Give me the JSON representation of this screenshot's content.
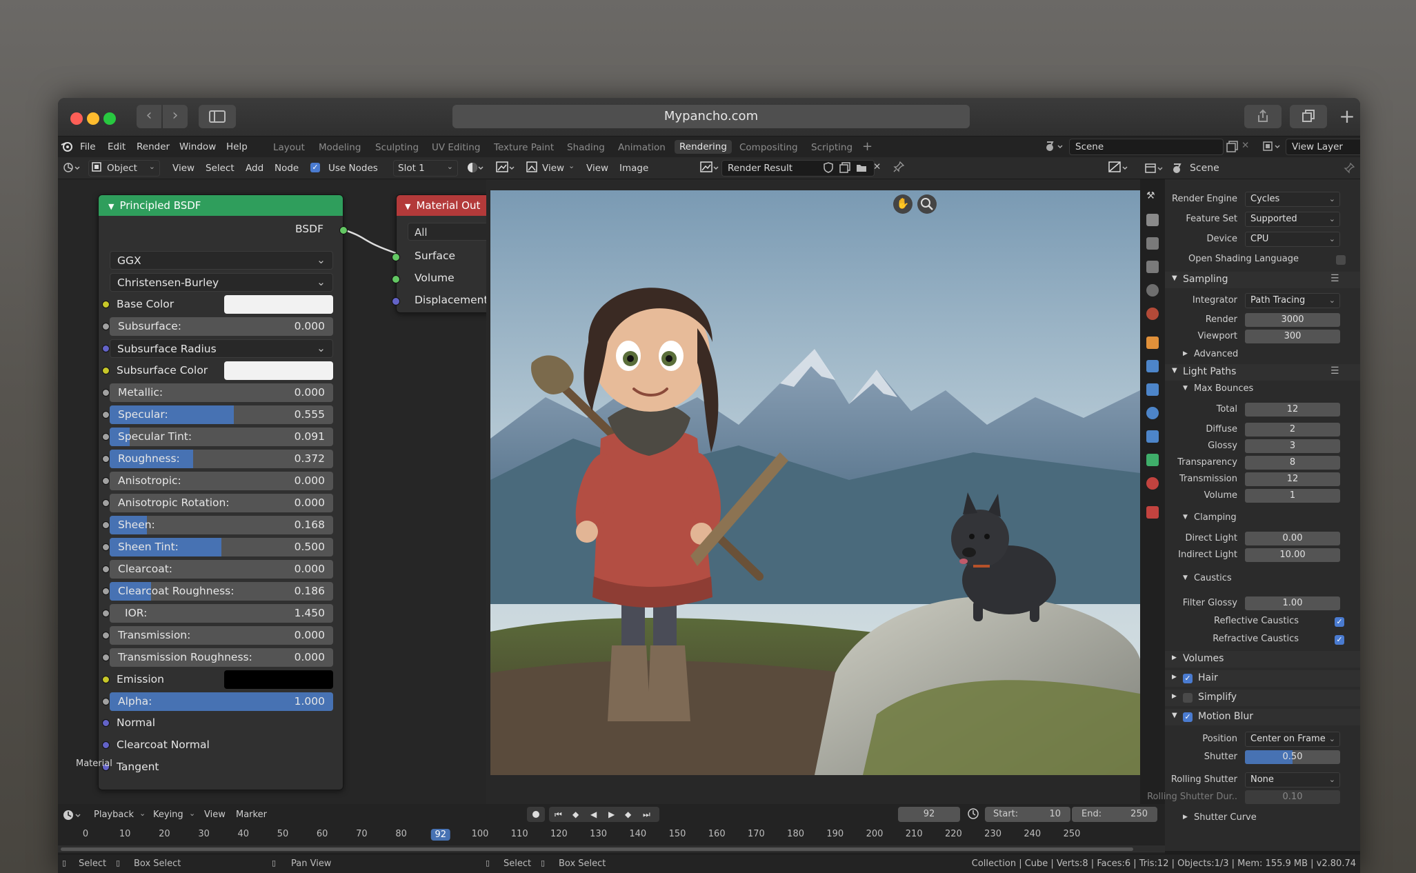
{
  "browser": {
    "url": "Mypancho.com"
  },
  "menu": {
    "items": [
      "File",
      "Edit",
      "Render",
      "Window",
      "Help"
    ],
    "workspaces": [
      "Layout",
      "Modeling",
      "Sculpting",
      "UV Editing",
      "Texture Paint",
      "Shading",
      "Animation",
      "Rendering",
      "Compositing",
      "Scripting"
    ],
    "active_workspace": "Rendering",
    "scene": "Scene",
    "view_layer": "View Layer"
  },
  "node_header": {
    "mode": "Object",
    "view": "View",
    "select": "Select",
    "add": "Add",
    "node": "Node",
    "use_nodes": "Use Nodes",
    "slot": "Slot 1"
  },
  "image_header": {
    "view": "View",
    "view2": "View",
    "image": "Image",
    "render_result": "Render Result"
  },
  "principled": {
    "title": "Principled BSDF",
    "output": "BSDF",
    "distribution": "GGX",
    "subsurface_method": "Christensen-Burley",
    "base_color": "Base Color",
    "subsurface": {
      "label": "Subsurface:",
      "value": "0.000",
      "fraction": 0
    },
    "subsurface_radius": "Subsurface Radius",
    "subsurface_color": "Subsurface Color",
    "metallic": {
      "label": "Metallic:",
      "value": "0.000",
      "fraction": 0
    },
    "specular": {
      "label": "Specular:",
      "value": "0.555",
      "fraction": 0.555
    },
    "specular_tint": {
      "label": "Specular Tint:",
      "value": "0.091",
      "fraction": 0.091
    },
    "roughness": {
      "label": "Roughness:",
      "value": "0.372",
      "fraction": 0.372
    },
    "anisotropic": {
      "label": "Anisotropic:",
      "value": "0.000",
      "fraction": 0
    },
    "anisotropic_rotation": {
      "label": "Anisotropic Rotation:",
      "value": "0.000",
      "fraction": 0
    },
    "sheen": {
      "label": "Sheen:",
      "value": "0.168",
      "fraction": 0.168
    },
    "sheen_tint": {
      "label": "Sheen Tint:",
      "value": "0.500",
      "fraction": 0.5
    },
    "clearcoat": {
      "label": "Clearcoat:",
      "value": "0.000",
      "fraction": 0
    },
    "clearcoat_roughness": {
      "label": "Clearcoat Roughness:",
      "value": "0.186",
      "fraction": 0.186
    },
    "ior": {
      "label": "IOR:",
      "value": "1.450",
      "fraction": 0
    },
    "transmission": {
      "label": "Transmission:",
      "value": "0.000",
      "fraction": 0
    },
    "transmission_roughness": {
      "label": "Transmission Roughness:",
      "value": "0.000",
      "fraction": 0
    },
    "emission": "Emission",
    "alpha": {
      "label": "Alpha:",
      "value": "1.000",
      "fraction": 1
    },
    "normal": "Normal",
    "clearcoat_normal": "Clearcoat Normal",
    "tangent": "Tangent",
    "frame_label": "Material"
  },
  "material_output": {
    "title": "Material Out",
    "target": "All",
    "surface": "Surface",
    "volume": "Volume",
    "displacement": "Displacement"
  },
  "properties": {
    "scene": "Scene",
    "render_engine": {
      "label": "Render Engine",
      "value": "Cycles"
    },
    "feature_set": {
      "label": "Feature Set",
      "value": "Supported"
    },
    "device": {
      "label": "Device",
      "value": "CPU"
    },
    "osl": "Open Shading Language",
    "sampling": "Sampling",
    "integrator": {
      "label": "Integrator",
      "value": "Path Tracing"
    },
    "render": {
      "label": "Render",
      "value": "3000"
    },
    "viewport": {
      "label": "Viewport",
      "value": "300"
    },
    "advanced": "Advanced",
    "light_paths": "Light Paths",
    "max_bounces": "Max Bounces",
    "total": {
      "label": "Total",
      "value": "12"
    },
    "diffuse": {
      "label": "Diffuse",
      "value": "2"
    },
    "glossy": {
      "label": "Glossy",
      "value": "3"
    },
    "transparency": {
      "label": "Transparency",
      "value": "8"
    },
    "transmission": {
      "label": "Transmission",
      "value": "12"
    },
    "volume": {
      "label": "Volume",
      "value": "1"
    },
    "clamping": "Clamping",
    "direct_light": {
      "label": "Direct Light",
      "value": "0.00"
    },
    "indirect_light": {
      "label": "Indirect Light",
      "value": "10.00"
    },
    "caustics": "Caustics",
    "filter_glossy": {
      "label": "Filter Glossy",
      "value": "1.00"
    },
    "reflective_caustics": "Reflective Caustics",
    "refractive_caustics": "Refractive Caustics",
    "volumes": "Volumes",
    "hair": "Hair",
    "simplify": "Simplify",
    "motion_blur": "Motion Blur",
    "position": {
      "label": "Position",
      "value": "Center on Frame"
    },
    "shutter": {
      "label": "Shutter",
      "value": "0.50",
      "fraction": 0.5
    },
    "rolling_shutter": {
      "label": "Rolling Shutter",
      "value": "None"
    },
    "rolling_shutter_dur": {
      "label": "Rolling Shutter Dur..",
      "value": "0.10"
    },
    "shutter_curve": "Shutter Curve"
  },
  "timeline": {
    "playback": "Playback",
    "keying": "Keying",
    "view": "View",
    "marker": "Marker",
    "current_frame": "92",
    "start_label": "Start:",
    "start": "10",
    "end_label": "End:",
    "end": "250",
    "ticks": [
      "0",
      "10",
      "20",
      "30",
      "40",
      "50",
      "60",
      "70",
      "80",
      "92",
      "100",
      "110",
      "120",
      "130",
      "140",
      "150",
      "160",
      "170",
      "180",
      "190",
      "200",
      "210",
      "220",
      "230",
      "240",
      "250"
    ]
  },
  "statusbar": {
    "select": "Select",
    "box_select": "Box Select",
    "pan_view": "Pan View",
    "select2": "Select",
    "box_select2": "Box Select",
    "stats": "Collection | Cube | Verts:8 | Faces:6 | Tris:12 | Objects:1/3 | Mem: 155.9 MB | v2.80.74"
  },
  "colors": {
    "accent_blue": "#4772b3",
    "node_green": "#2f9e5c",
    "node_red": "#b33a3a",
    "socket_yellow": "#c7c729",
    "socket_grey": "#a1a1a1",
    "socket_purple": "#6363c7",
    "socket_green": "#63c763"
  }
}
